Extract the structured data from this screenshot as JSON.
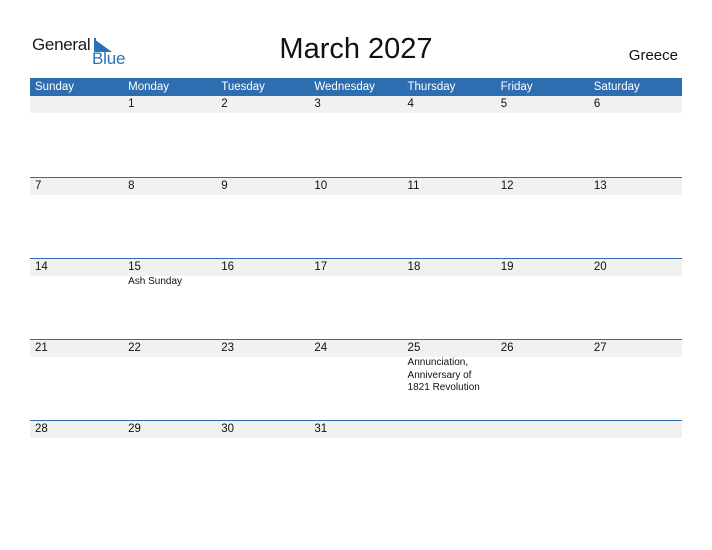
{
  "logo": {
    "word1": "General",
    "word2": "Blue",
    "accent": "#2a72b5"
  },
  "title": "March 2027",
  "country": "Greece",
  "colors": {
    "header_bg": "#2e6eb0",
    "strip_bg": "#f1f1f1"
  },
  "weekdays": [
    "Sunday",
    "Monday",
    "Tuesday",
    "Wednesday",
    "Thursday",
    "Friday",
    "Saturday"
  ],
  "weeks": [
    [
      {
        "day": ""
      },
      {
        "day": "1"
      },
      {
        "day": "2"
      },
      {
        "day": "3"
      },
      {
        "day": "4"
      },
      {
        "day": "5"
      },
      {
        "day": "6"
      }
    ],
    [
      {
        "day": "7"
      },
      {
        "day": "8"
      },
      {
        "day": "9"
      },
      {
        "day": "10"
      },
      {
        "day": "11"
      },
      {
        "day": "12"
      },
      {
        "day": "13"
      }
    ],
    [
      {
        "day": "14"
      },
      {
        "day": "15",
        "event": "Ash Sunday"
      },
      {
        "day": "16"
      },
      {
        "day": "17"
      },
      {
        "day": "18"
      },
      {
        "day": "19"
      },
      {
        "day": "20"
      }
    ],
    [
      {
        "day": "21"
      },
      {
        "day": "22"
      },
      {
        "day": "23"
      },
      {
        "day": "24"
      },
      {
        "day": "25",
        "event": "Annunciation,\nAnniversary of\n1821 Revolution"
      },
      {
        "day": "26"
      },
      {
        "day": "27"
      }
    ],
    [
      {
        "day": "28"
      },
      {
        "day": "29"
      },
      {
        "day": "30"
      },
      {
        "day": "31"
      },
      {
        "day": ""
      },
      {
        "day": ""
      },
      {
        "day": ""
      }
    ]
  ]
}
